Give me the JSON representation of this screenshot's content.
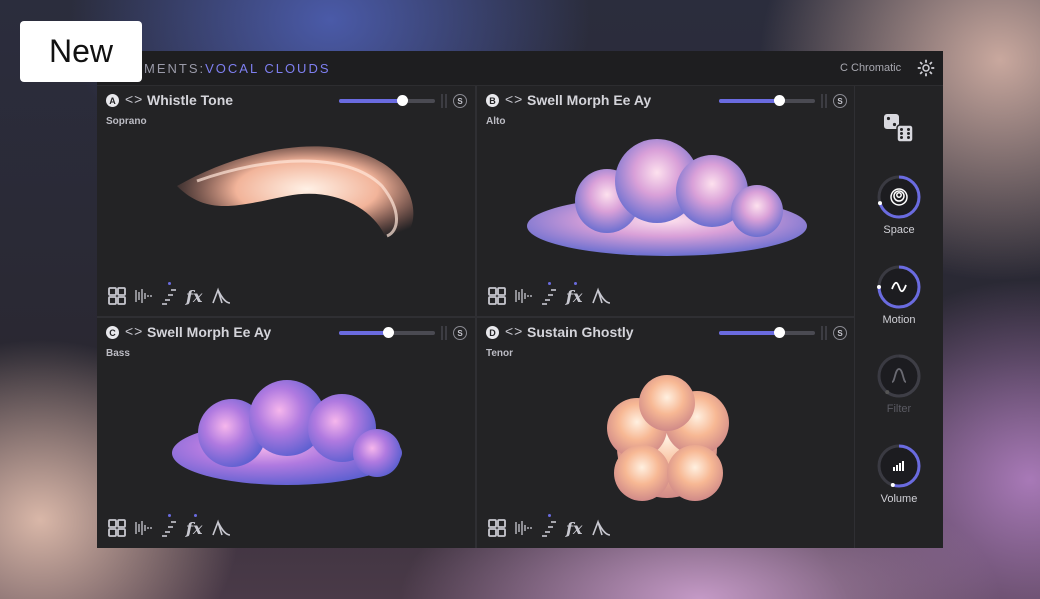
{
  "badge": "New",
  "header": {
    "title_prefix": "MENTS:",
    "title_sub": "VOCAL CLOUDS",
    "scale": "C  Chromatic"
  },
  "slots": [
    {
      "letter": "A",
      "name": "Whistle Tone",
      "voice": "Soprano",
      "volume_pct": 66,
      "fx_active": false
    },
    {
      "letter": "B",
      "name": "Swell Morph Ee Ay",
      "voice": "Alto",
      "volume_pct": 62,
      "fx_active": true
    },
    {
      "letter": "C",
      "name": "Swell Morph Ee Ay",
      "voice": "Bass",
      "volume_pct": 51,
      "fx_active": true
    },
    {
      "letter": "D",
      "name": "Sustain Ghostly",
      "voice": "Tenor",
      "volume_pct": 62,
      "fx_active": false
    }
  ],
  "solo_label": "S",
  "arrows": "<>",
  "macros": [
    {
      "label": "Space",
      "value_pct": 70,
      "enabled": true,
      "icon": "spiral-icon"
    },
    {
      "label": "Motion",
      "value_pct": 75,
      "enabled": true,
      "icon": "wave-icon"
    },
    {
      "label": "Filter",
      "value_pct": 60,
      "enabled": false,
      "icon": "bell-curve-icon"
    },
    {
      "label": "Volume",
      "value_pct": 55,
      "enabled": true,
      "icon": "bars-icon"
    }
  ],
  "colors": {
    "accent": "#6a6be0",
    "panel": "#232325"
  }
}
